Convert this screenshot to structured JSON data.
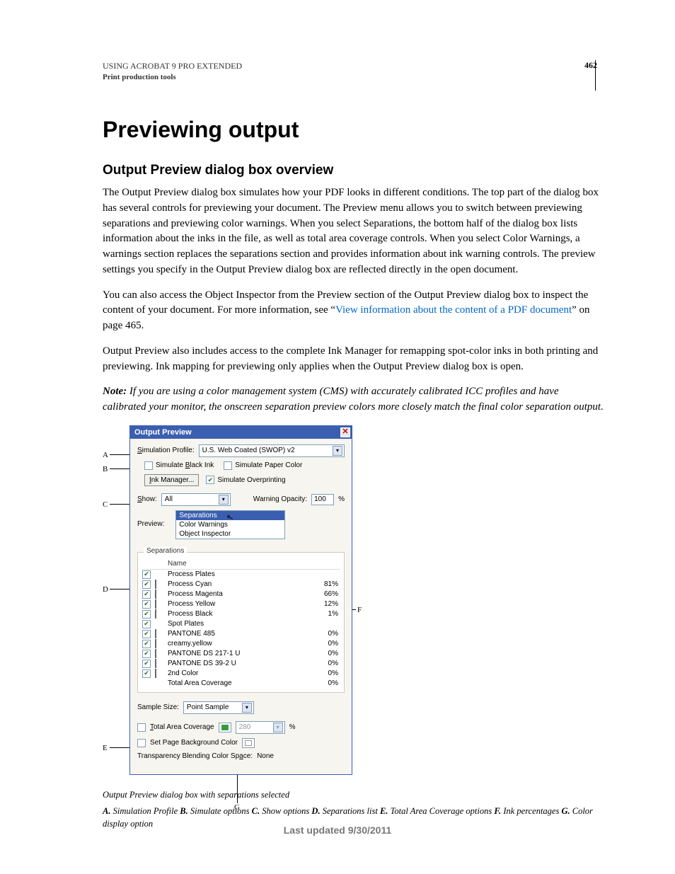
{
  "header": {
    "line1": "USING ACROBAT 9 PRO EXTENDED",
    "line2": "Print production tools",
    "pageNum": "462"
  },
  "h1": "Previewing output",
  "h2": "Output Preview dialog box overview",
  "p1": "The Output Preview dialog box simulates how your PDF looks in different conditions. The top part of the dialog box has several controls for previewing your document. The Preview menu allows you to switch between previewing separations and previewing color warnings. When you select Separations, the bottom half of the dialog box lists information about the inks in the file, as well as total area coverage controls. When you select Color Warnings, a warnings section replaces the separations section and provides information about ink warning controls. The preview settings you specify in the Output Preview dialog box are reflected directly in the open document.",
  "p2a": "You can also access the Object Inspector from the Preview section of the Output Preview dialog box to inspect the content of your document. For more information, see “",
  "p2link": "View information about the content of a PDF document",
  "p2b": "” on page 465.",
  "p3": "Output Preview also includes access to the complete Ink Manager for remapping spot-color inks in both printing and previewing. Ink mapping for previewing only applies when the Output Preview dialog box is open.",
  "noteLead": "Note:",
  "noteBody": " If you are using a color management system (CMS) with accurately calibrated ICC profiles and have calibrated your monitor, the onscreen separation preview colors more closely match the final color separation output.",
  "dialog": {
    "title": "Output Preview",
    "simProfileLabel": "Simulation Profile:",
    "simProfileValue": "U.S. Web Coated (SWOP) v2",
    "simBlack": "Simulate Black Ink",
    "simPaper": "Simulate Paper Color",
    "inkManager": "Ink Manager...",
    "simOverprint": "Simulate Overprinting",
    "showLabel": "Show:",
    "showValue": "All",
    "warnOpLabel": "Warning Opacity:",
    "warnOpValue": "100",
    "pctSign": "%",
    "previewLabel": "Preview:",
    "previewOptions": [
      "Separations",
      "Color Warnings",
      "Object Inspector"
    ],
    "sepsTitle": "Separations",
    "nameHeader": "Name",
    "inks": [
      {
        "name": "Process Plates",
        "pct": "",
        "color": ""
      },
      {
        "name": "Process Cyan",
        "pct": "81%",
        "color": "#00a6d6"
      },
      {
        "name": "Process Magenta",
        "pct": "66%",
        "color": "#d6127e"
      },
      {
        "name": "Process Yellow",
        "pct": "12%",
        "color": "#f2e000"
      },
      {
        "name": "Process Black",
        "pct": "1%",
        "color": "#000000"
      },
      {
        "name": "Spot Plates",
        "pct": "",
        "color": ""
      },
      {
        "name": "PANTONE 485",
        "pct": "0%",
        "color": "#d2232a"
      },
      {
        "name": "creamy.yellow",
        "pct": "0%",
        "color": "#f2e4a0"
      },
      {
        "name": "PANTONE DS 217-1 U",
        "pct": "0%",
        "color": "#9b1b55"
      },
      {
        "name": "PANTONE DS 39-2 U",
        "pct": "0%",
        "color": "#b0203a"
      },
      {
        "name": "2nd Color",
        "pct": "0%",
        "color": "#0070c0"
      },
      {
        "name": "Total Area Coverage",
        "pct": "0%",
        "color": ""
      }
    ],
    "sampleSizeLabel": "Sample Size:",
    "sampleSizeValue": "Point Sample",
    "tacLabel": "Total Area Coverage",
    "tacColor": "#3a9b3a",
    "tacValue": "280",
    "setPageBg": "Set Page Background Color",
    "transparencyLabel": "Transparency Blending Color Space:",
    "transparencyValue": "None"
  },
  "callouts": {
    "A": "A",
    "B": "B",
    "C": "C",
    "D": "D",
    "E": "E",
    "F": "F",
    "G": "G"
  },
  "caption1": "Output Preview dialog box with separations selected",
  "caption2": {
    "A": "A.",
    "At": " Simulation Profile  ",
    "B": "B.",
    "Bt": " Simulate options  ",
    "C": "C.",
    "Ct": " Show options  ",
    "D": "D.",
    "Dt": " Separations list  ",
    "E": "E.",
    "Et": " Total Area Coverage options  ",
    "F": "F.",
    "Ft": " Ink percentages  ",
    "G": "G.",
    "Gt": " Color display option  "
  },
  "footer": "Last updated 9/30/2011"
}
